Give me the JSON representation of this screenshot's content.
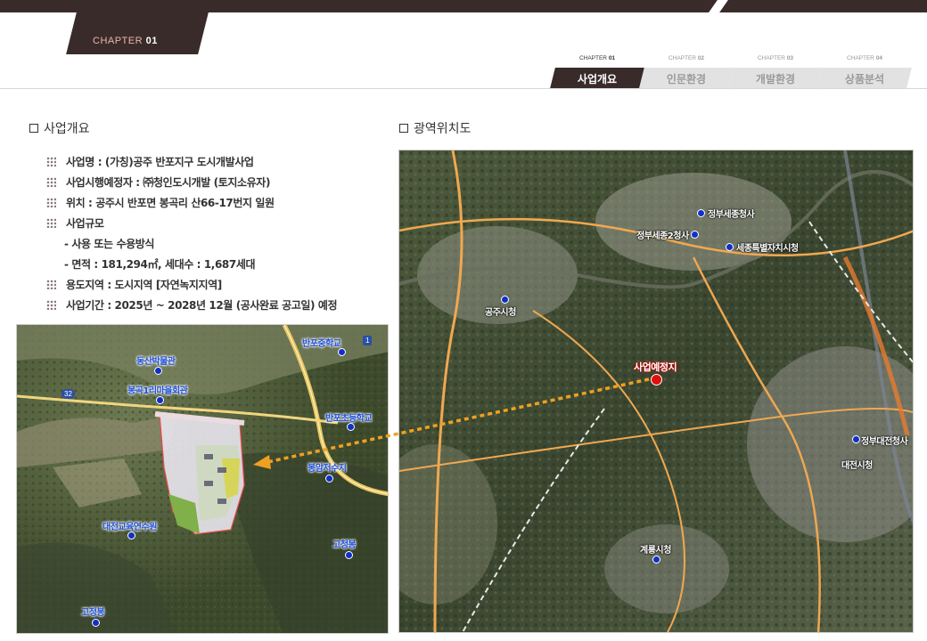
{
  "header": {
    "chapter_prefix": "CHAPTER ",
    "chapter_num": "01"
  },
  "chapter_nav": [
    {
      "prefix": "CHAPTER ",
      "num": "01",
      "label": "사업개요",
      "active": true
    },
    {
      "prefix": "CHAPTER ",
      "num": "02",
      "label": "인문환경",
      "active": false
    },
    {
      "prefix": "CHAPTER ",
      "num": "03",
      "label": "개발환경",
      "active": false
    },
    {
      "prefix": "CHAPTER ",
      "num": "04",
      "label": "상품분석",
      "active": false
    }
  ],
  "overview_section": {
    "title": "사업개요",
    "items": {
      "name": "사업명 : (가칭)공주 반포지구 도시개발사업",
      "operator": "사업시행예정자 : ㈜청인도시개발 (토지소유자)",
      "location": "위치 : 공주시 반포면 봉곡리 산66-17번지 일원",
      "scale": "사업규모",
      "scale_method": "- 사용 또는 수용방식",
      "scale_area": "-  면적 : 181,294㎡, 세대수 : 1,687세대",
      "zoning": "용도지역 : 도시지역 [자연녹지지역]",
      "period": "사업기간 : 2025년 ~ 2028년 12월 (공사완료 공고일) 예정"
    }
  },
  "location_section": {
    "title": "광역위치도"
  },
  "local_map": {
    "labels": {
      "school_middle": "반포중학교",
      "museum": "동산박물관",
      "village_hall": "봉곡1리마을회관",
      "school_elem": "반포초등학교",
      "reservoir": "봉암저수지",
      "arboretum": "대전교육연수원",
      "peak1": "고청봉",
      "peak2": "고정봉"
    },
    "routes": {
      "r32": "32",
      "r1": "1"
    }
  },
  "regional_map": {
    "labels": {
      "site": "사업예정지",
      "gongju": "공주시청",
      "sejong_gov": "정부세종청사",
      "sejong_gov2": "정부세종2청사",
      "sejong_city": "세종특별자치시청",
      "daejeon_gov": "정부대전청사",
      "daejeon_city": "대전시청",
      "gyeryong": "계룡시청"
    }
  },
  "colors": {
    "brand_dark": "#3a2b2b",
    "accent_orange": "#f0a020",
    "pin_blue": "#1030c8",
    "pin_red": "#e10f0f"
  }
}
